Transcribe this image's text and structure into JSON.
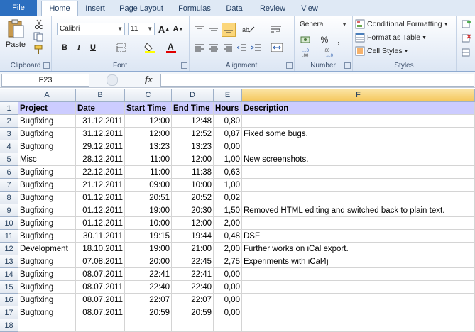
{
  "tabs": [
    "File",
    "Home",
    "Insert",
    "Page Layout",
    "Formulas",
    "Data",
    "Review",
    "View"
  ],
  "clipboard": {
    "paste": "Paste",
    "label": "Clipboard"
  },
  "font": {
    "name": "Calibri",
    "size": "11",
    "bold": "B",
    "italic": "I",
    "underline": "U",
    "label": "Font"
  },
  "alignment": {
    "label": "Alignment"
  },
  "number": {
    "format": "General",
    "percent": "%",
    "comma": ",",
    "label": "Number"
  },
  "styles": {
    "conditional": "Conditional Formatting",
    "format_table": "Format as Table",
    "cell_styles": "Cell Styles",
    "label": "Styles"
  },
  "formula_bar": {
    "name_box": "F23",
    "fx": "fx",
    "value": ""
  },
  "columns": [
    "A",
    "B",
    "C",
    "D",
    "E",
    "F"
  ],
  "rows": [
    [
      "Project",
      "Date",
      "Start Time",
      "End Time",
      "Hours",
      "Description"
    ],
    [
      "Bugfixing",
      "31.12.2011",
      "12:00",
      "12:48",
      "0,80",
      ""
    ],
    [
      "Bugfixing",
      "31.12.2011",
      "12:00",
      "12:52",
      "0,87",
      "Fixed some bugs."
    ],
    [
      "Bugfixing",
      "29.12.2011",
      "13:23",
      "13:23",
      "0,00",
      ""
    ],
    [
      "Misc",
      "28.12.2011",
      "11:00",
      "12:00",
      "1,00",
      "New screenshots."
    ],
    [
      "Bugfixing",
      "22.12.2011",
      "11:00",
      "11:38",
      "0,63",
      ""
    ],
    [
      "Bugfixing",
      "21.12.2011",
      "09:00",
      "10:00",
      "1,00",
      ""
    ],
    [
      "Bugfixing",
      "01.12.2011",
      "20:51",
      "20:52",
      "0,02",
      ""
    ],
    [
      "Bugfixing",
      "01.12.2011",
      "19:00",
      "20:30",
      "1,50",
      "Removed HTML editing and switched back to plain text."
    ],
    [
      "Bugfixing",
      "01.12.2011",
      "10:00",
      "12:00",
      "2,00",
      ""
    ],
    [
      "Bugfixing",
      "30.11.2011",
      "19:15",
      "19:44",
      "0,48",
      "DSF"
    ],
    [
      "Development",
      "18.10.2011",
      "19:00",
      "21:00",
      "2,00",
      "Further works on iCal export."
    ],
    [
      "Bugfixing",
      "07.08.2011",
      "20:00",
      "22:45",
      "2,75",
      "Experiments with iCal4j"
    ],
    [
      "Bugfixing",
      "08.07.2011",
      "22:41",
      "22:41",
      "0,00",
      ""
    ],
    [
      "Bugfixing",
      "08.07.2011",
      "22:40",
      "22:40",
      "0,00",
      ""
    ],
    [
      "Bugfixing",
      "08.07.2011",
      "22:07",
      "22:07",
      "0,00",
      ""
    ],
    [
      "Bugfixing",
      "08.07.2011",
      "20:59",
      "20:59",
      "0,00",
      ""
    ],
    [
      "",
      "",
      "",
      "",
      "",
      ""
    ]
  ],
  "row_numbers": [
    "1",
    "2",
    "3",
    "4",
    "5",
    "6",
    "7",
    "8",
    "9",
    "10",
    "11",
    "12",
    "13",
    "14",
    "15",
    "16",
    "17",
    "18"
  ]
}
